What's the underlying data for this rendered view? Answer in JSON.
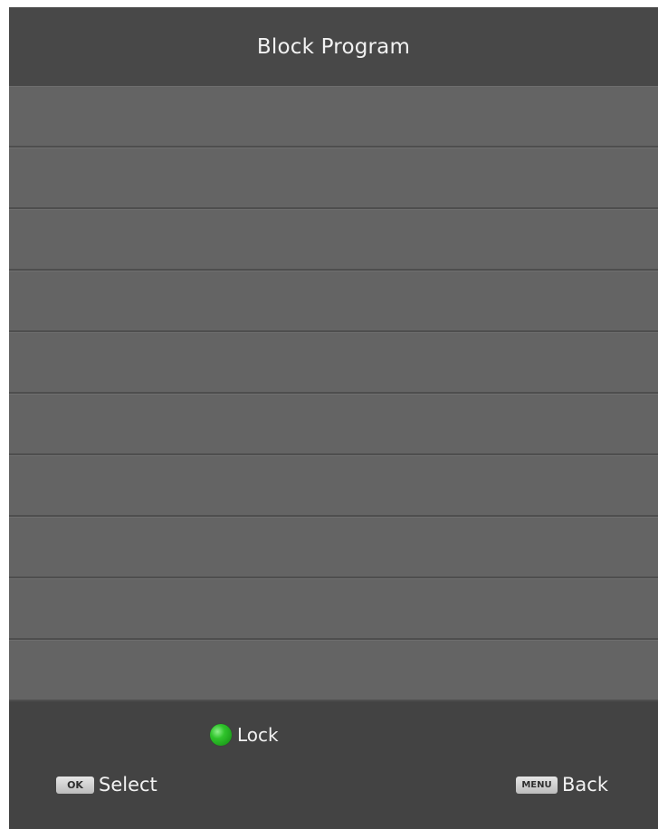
{
  "screen": {
    "title": "Block Program",
    "list_row_count": 10
  },
  "legend": {
    "icon": "green-circle-icon",
    "label": "Lock",
    "color": "#2fc42b"
  },
  "hints": {
    "select": {
      "key": "OK",
      "label": "Select"
    },
    "back": {
      "key": "MENU",
      "label": "Back"
    }
  },
  "colors": {
    "header_bg": "#484848",
    "row_bg": "#646464",
    "footer_bg": "#434343",
    "text": "#f2f2f2"
  }
}
